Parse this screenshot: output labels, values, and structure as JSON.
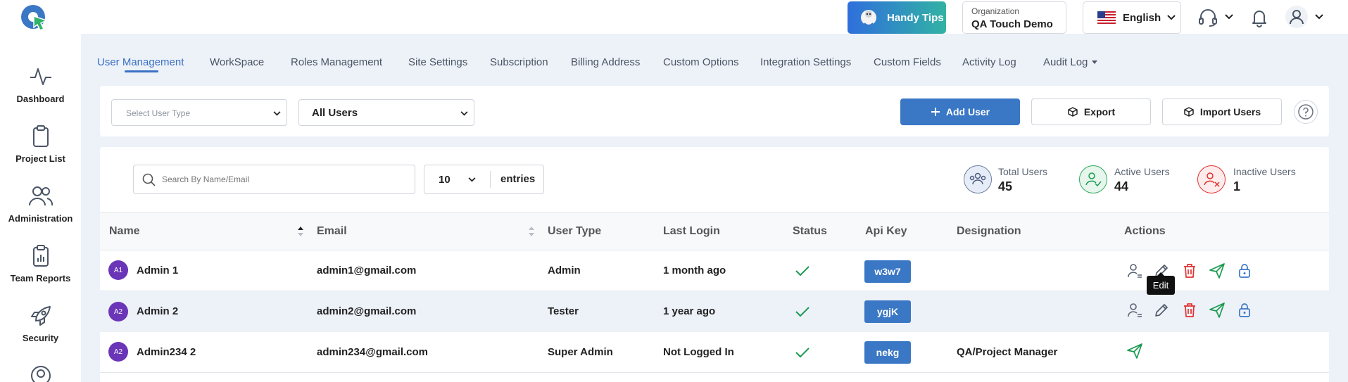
{
  "header": {
    "handy_tips": "Handy Tips",
    "org_label": "Organization",
    "org_name": "QA Touch Demo",
    "language": "English"
  },
  "sidebar": {
    "items": [
      {
        "label": "Dashboard"
      },
      {
        "label": "Project List"
      },
      {
        "label": "Administration"
      },
      {
        "label": "Team Reports"
      },
      {
        "label": "Security"
      }
    ]
  },
  "tabs": [
    "User Management",
    "WorkSpace",
    "Roles Management",
    "Site Settings",
    "Subscription",
    "Billing Address",
    "Custom Options",
    "Integration Settings",
    "Custom Fields",
    "Activity Log",
    "Audit Log"
  ],
  "filters": {
    "user_type_placeholder": "Select User Type",
    "user_scope": "All Users"
  },
  "buttons": {
    "add_user": "Add User",
    "export": "Export",
    "import_users": "Import Users"
  },
  "search": {
    "placeholder": "Search By Name/Email"
  },
  "entries": {
    "value": "10",
    "label": "entries"
  },
  "stats": [
    {
      "label": "Total Users",
      "value": "45"
    },
    {
      "label": "Active Users",
      "value": "44"
    },
    {
      "label": "Inactive Users",
      "value": "1"
    }
  ],
  "table": {
    "headers": [
      "Name",
      "Email",
      "User Type",
      "Last Login",
      "Status",
      "Api Key",
      "Designation",
      "Actions"
    ],
    "rows": [
      {
        "initials": "A1",
        "name": "Admin 1",
        "email": "admin1@gmail.com",
        "type": "Admin",
        "last_login": "1 month ago",
        "api_key": "w3w7",
        "designation": ""
      },
      {
        "initials": "A2",
        "name": "Admin 2",
        "email": "admin2@gmail.com",
        "type": "Tester",
        "last_login": "1 year ago",
        "api_key": "ygjK",
        "designation": ""
      },
      {
        "initials": "A2",
        "name": "Admin234 2",
        "email": "admin234@gmail.com",
        "type": "Super Admin",
        "last_login": "Not Logged In",
        "api_key": "nekg",
        "designation": "QA/Project Manager"
      }
    ]
  },
  "tooltip": "Edit",
  "colors": {
    "primary": "#3a77c5",
    "active_tab": "#3a71c4",
    "success": "#1a9a50",
    "danger": "#e03131",
    "avatar": "#6a35b7",
    "page_bg": "#edf1f8"
  }
}
